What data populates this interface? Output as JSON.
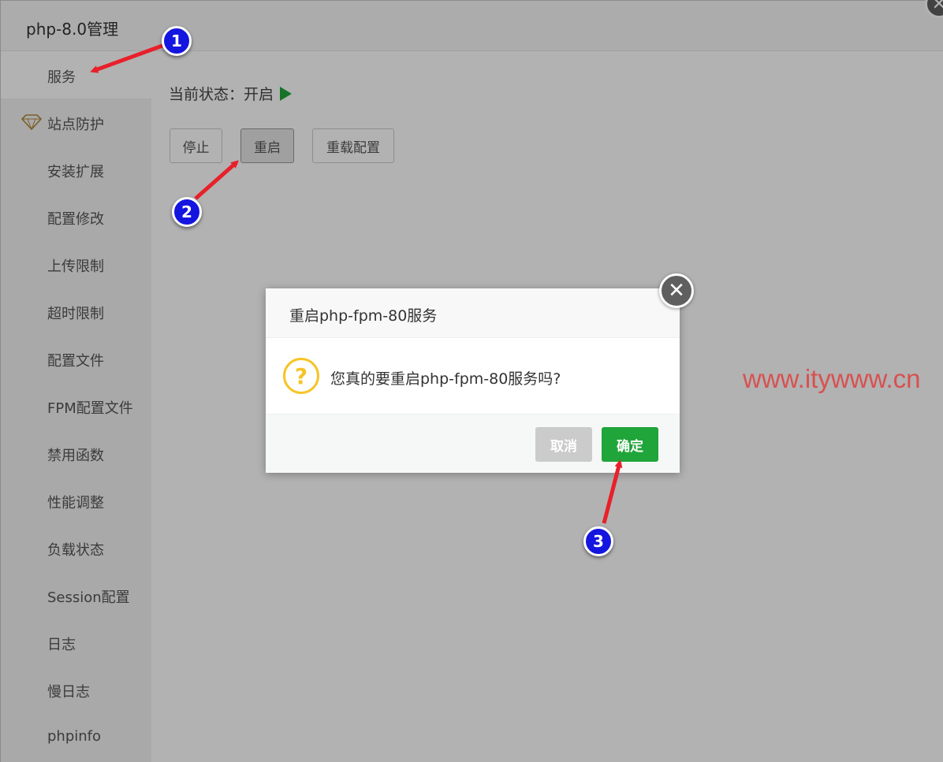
{
  "panel": {
    "title": "php-8.0管理",
    "close_glyph": "✕"
  },
  "sidebar": {
    "items": [
      {
        "label": "服务",
        "active": true
      },
      {
        "label": "站点防护",
        "icon": "diamond-shield-icon"
      },
      {
        "label": "安装扩展"
      },
      {
        "label": "配置修改"
      },
      {
        "label": "上传限制"
      },
      {
        "label": "超时限制"
      },
      {
        "label": "配置文件"
      },
      {
        "label": "FPM配置文件"
      },
      {
        "label": "禁用函数"
      },
      {
        "label": "性能调整"
      },
      {
        "label": "负载状态"
      },
      {
        "label": "Session配置"
      },
      {
        "label": "日志"
      },
      {
        "label": "慢日志"
      },
      {
        "label": "phpinfo"
      }
    ]
  },
  "service": {
    "status_label": "当前状态：开启",
    "status_color": "#20a53a",
    "buttons": {
      "stop": "停止",
      "restart": "重启",
      "reload": "重载配置"
    }
  },
  "dialog": {
    "title": "重启php-fpm-80服务",
    "message": "您真的要重启php-fpm-80服务吗?",
    "question_glyph": "?",
    "cancel_label": "取消",
    "confirm_label": "确定",
    "confirm_color": "#20a53a",
    "close_glyph": "✕"
  },
  "annotations": {
    "step1": "1",
    "step2": "2",
    "step3": "3"
  },
  "watermark": "www.itywww.cn"
}
